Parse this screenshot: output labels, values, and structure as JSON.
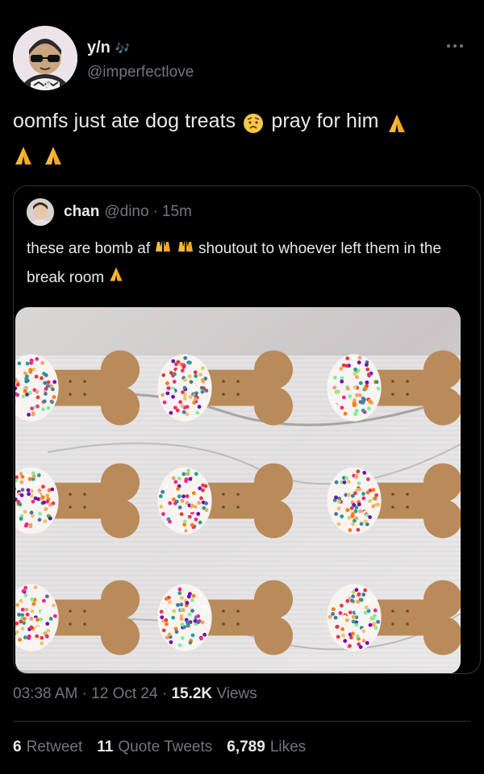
{
  "author": {
    "display_name": "y/n",
    "name_emoji": "🎶",
    "handle": "@imperfectlove"
  },
  "tweet": {
    "text_1": "oomfs just ate dog treats",
    "text_2": "pray for him",
    "emoji_worried": "😟",
    "emoji_pray": "🙏"
  },
  "quoted": {
    "name": "chan",
    "handle": "@dino",
    "separator": "·",
    "age": "15m",
    "text_1": "these are bomb af",
    "text_2": "shoutout to whoever left them in the break room",
    "emoji_hands": "🙌"
  },
  "meta": {
    "time": "03:38 AM",
    "separator": "·",
    "date": "12 Oct 24",
    "views_count": "15.2K",
    "views_label": "Views"
  },
  "stats": {
    "retweets_count": "6",
    "retweets_label": "Retweet",
    "quotes_count": "11",
    "quotes_label": "Quote Tweets",
    "likes_count": "6,789",
    "likes_label": "Likes"
  },
  "colors": {
    "background": "#000000",
    "text_primary": "#e7e9ea",
    "text_secondary": "#71767b",
    "border": "#2f3336"
  }
}
